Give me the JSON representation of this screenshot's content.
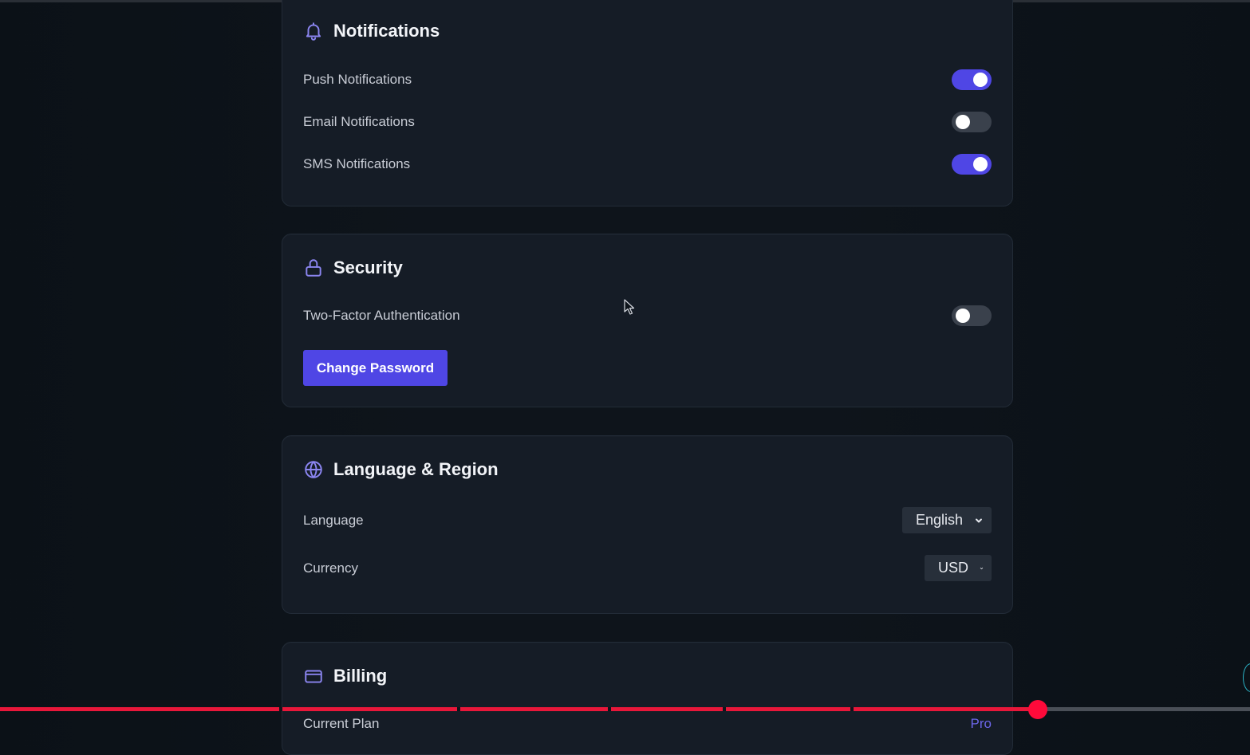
{
  "notifications": {
    "title": "Notifications",
    "icon": "bell-icon",
    "items": [
      {
        "label": "Push Notifications",
        "enabled": true
      },
      {
        "label": "Email Notifications",
        "enabled": false
      },
      {
        "label": "SMS Notifications",
        "enabled": true
      }
    ]
  },
  "security": {
    "title": "Security",
    "icon": "lock-icon",
    "two_factor_label": "Two-Factor Authentication",
    "two_factor_enabled": false,
    "change_password_label": "Change Password"
  },
  "language_region": {
    "title": "Language & Region",
    "icon": "globe-icon",
    "language_label": "Language",
    "language_value": "English",
    "currency_label": "Currency",
    "currency_value": "USD"
  },
  "billing": {
    "title": "Billing",
    "icon": "credit-card-icon",
    "current_plan_label": "Current Plan",
    "current_plan_value": "Pro"
  },
  "video_progress": {
    "played_fraction": 0.83
  },
  "colors": {
    "accent": "#4f46e5",
    "background": "#0e141b",
    "card": "#151c26",
    "progress": "#e8173a"
  }
}
